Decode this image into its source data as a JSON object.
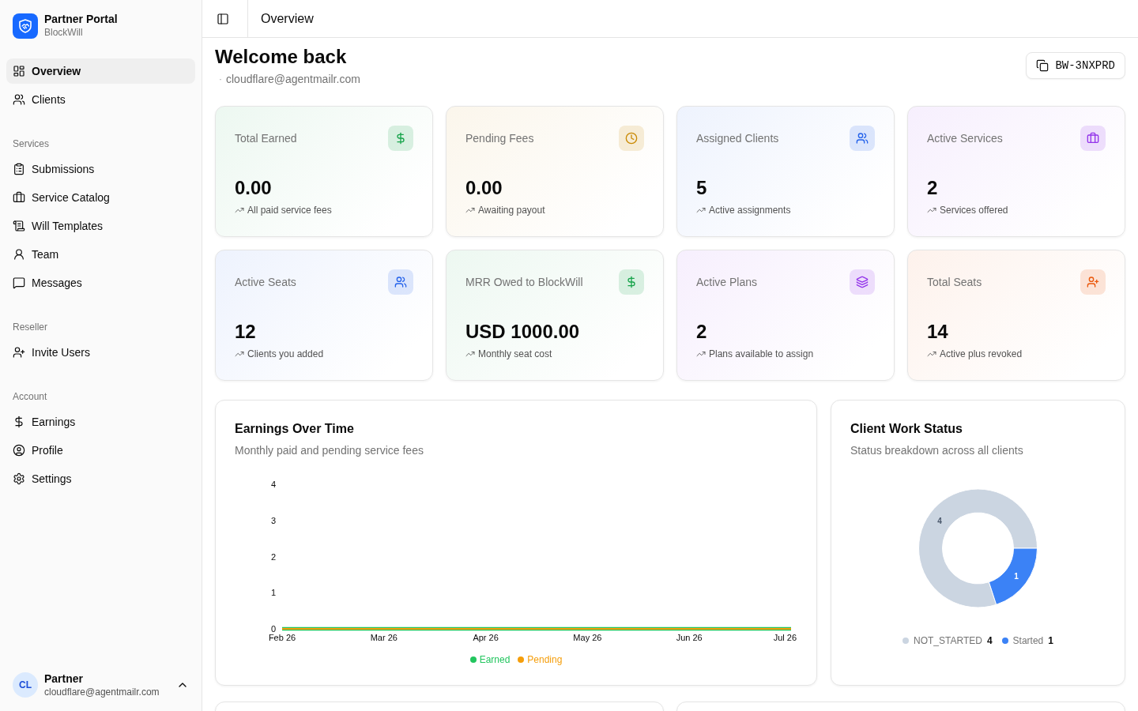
{
  "sidebar": {
    "brand": {
      "title": "Partner Portal",
      "subtitle": "BlockWill"
    },
    "groups": [
      {
        "items": [
          {
            "label": "Overview",
            "selected": true
          },
          {
            "label": "Clients",
            "selected": false
          }
        ]
      },
      {
        "label": "Services",
        "items": [
          {
            "label": "Submissions",
            "selected": false
          },
          {
            "label": "Service Catalog",
            "selected": false
          },
          {
            "label": "Will Templates",
            "selected": false
          },
          {
            "label": "Team",
            "selected": false
          },
          {
            "label": "Messages",
            "selected": false
          }
        ]
      },
      {
        "label": "Reseller",
        "items": [
          {
            "label": "Invite Users",
            "selected": false
          }
        ]
      },
      {
        "label": "Account",
        "items": [
          {
            "label": "Earnings",
            "selected": false
          },
          {
            "label": "Profile",
            "selected": false
          },
          {
            "label": "Settings",
            "selected": false
          }
        ]
      }
    ],
    "user": {
      "initials": "CL",
      "name": "Partner",
      "email": "cloudflare@agentmailr.com"
    }
  },
  "header": {
    "title": "Overview"
  },
  "welcome": {
    "title": "Welcome back",
    "separator": "·",
    "email": "cloudflare@agentmailr.com",
    "code_button": "BW-3NXPRD"
  },
  "stats": [
    {
      "label": "Total Earned",
      "value": "0.00",
      "note": "All paid service fees",
      "color": "#16a34a"
    },
    {
      "label": "Pending Fees",
      "value": "0.00",
      "note": "Awaiting payout",
      "color": "#ca8a04"
    },
    {
      "label": "Assigned Clients",
      "value": "5",
      "note": "Active assignments",
      "color": "#2563eb"
    },
    {
      "label": "Active Services",
      "value": "2",
      "note": "Services offered",
      "color": "#9333ea"
    },
    {
      "label": "Active Seats",
      "value": "12",
      "note": "Clients you added",
      "color": "#2563eb"
    },
    {
      "label": "MRR Owed to BlockWill",
      "value": "USD 1000.00",
      "note": "Monthly seat cost",
      "color": "#16a34a"
    },
    {
      "label": "Active Plans",
      "value": "2",
      "note": "Plans available to assign",
      "color": "#9333ea"
    },
    {
      "label": "Total Seats",
      "value": "14",
      "note": "Active plus revoked",
      "color": "#ea580c"
    }
  ],
  "earnings_chart": {
    "title": "Earnings Over Time",
    "subtitle": "Monthly paid and pending service fees",
    "chart_data": {
      "type": "line",
      "categories": [
        "Feb 26",
        "Mar 26",
        "Apr 26",
        "May 26",
        "Jun 26",
        "Jul 26"
      ],
      "series": [
        {
          "name": "Earned",
          "color": "#22c55e",
          "values": [
            0,
            0,
            0,
            0,
            0,
            0
          ]
        },
        {
          "name": "Pending",
          "color": "#f59e0b",
          "values": [
            0,
            0,
            0,
            0,
            0,
            0
          ]
        }
      ],
      "ylim": [
        0,
        4
      ],
      "yticks": [
        0,
        1,
        2,
        3,
        4
      ]
    }
  },
  "status_chart": {
    "title": "Client Work Status",
    "subtitle": "Status breakdown across all clients",
    "chart_data": {
      "type": "donut",
      "categories": [
        "NOT_STARTED",
        "Started"
      ],
      "values": [
        4,
        1
      ],
      "data_labels": true
    },
    "legend": [
      {
        "count": "4",
        "color": "#cbd5e1"
      },
      {
        "count": "1",
        "color": "#3b82f6"
      }
    ]
  }
}
